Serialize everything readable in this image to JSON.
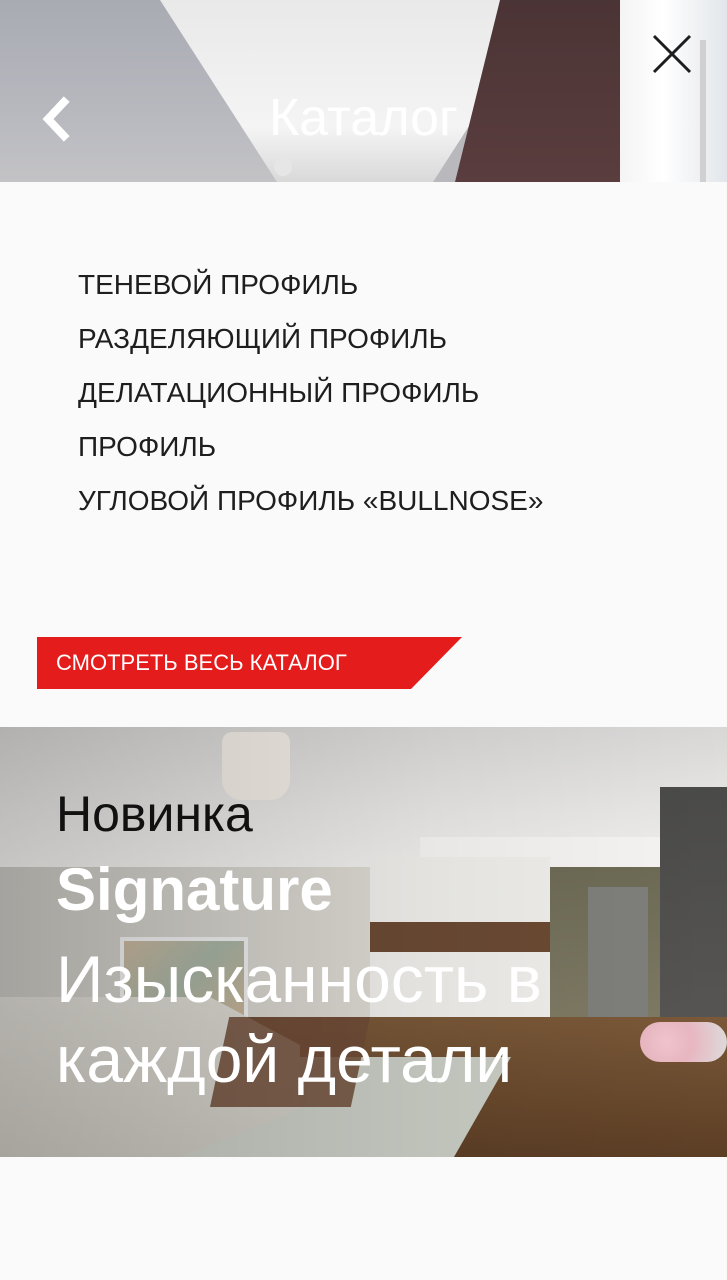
{
  "header": {
    "title": "Каталог",
    "back_icon": "chevron-left-icon",
    "close_icon": "close-icon"
  },
  "menu": {
    "items": [
      {
        "label": "ТЕНЕВОЙ ПРОФИЛЬ"
      },
      {
        "label": "РАЗДЕЛЯЮЩИЙ ПРОФИЛЬ"
      },
      {
        "label": "ДЕЛАТАЦИОННЫЙ ПРОФИЛЬ"
      },
      {
        "label": "ПРОФИЛЬ"
      },
      {
        "label": "УГЛОВОЙ ПРОФИЛЬ «BULLNOSE»"
      }
    ]
  },
  "cta": {
    "label": "СМОТРЕТЬ ВЕСЬ КАТАЛОГ",
    "color": "#e41c1c"
  },
  "promo": {
    "eyebrow": "Новинка",
    "product": "Signature",
    "tagline": "Изысканность в каждой детали"
  }
}
